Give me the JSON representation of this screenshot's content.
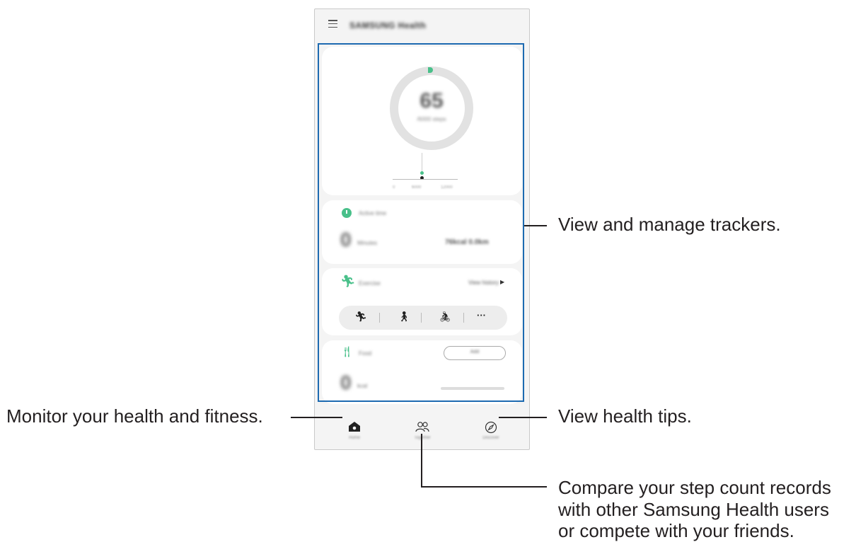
{
  "app": {
    "title": "SAMSUNG Health"
  },
  "steps_card": {
    "steps": "65",
    "steps_label": "/6000 steps",
    "tick_labels": [
      "0",
      "6000",
      "12000"
    ]
  },
  "active_time_card": {
    "title": "Active time",
    "value": "0",
    "unit": "Minutes",
    "stats": "76kcal  0.0km"
  },
  "exercise_card": {
    "title": "Exercise",
    "view_history": "View history",
    "more": "···"
  },
  "food_card": {
    "title": "Food",
    "record_button": "Add",
    "value": "0",
    "unit": "kcal"
  },
  "bottom_nav": {
    "home": "Home",
    "together": "Together",
    "discover": "Discover"
  },
  "callouts": {
    "trackers": "View and manage trackers.",
    "home": "Monitor your health and fitness.",
    "tips": "View health tips.",
    "together_line1": "Compare your step count records",
    "together_line2": "with other Samsung Health users",
    "together_line3": "or compete with your friends."
  },
  "colors": {
    "accent_green": "#49c08a",
    "highlight_blue": "#1d6ab1"
  }
}
